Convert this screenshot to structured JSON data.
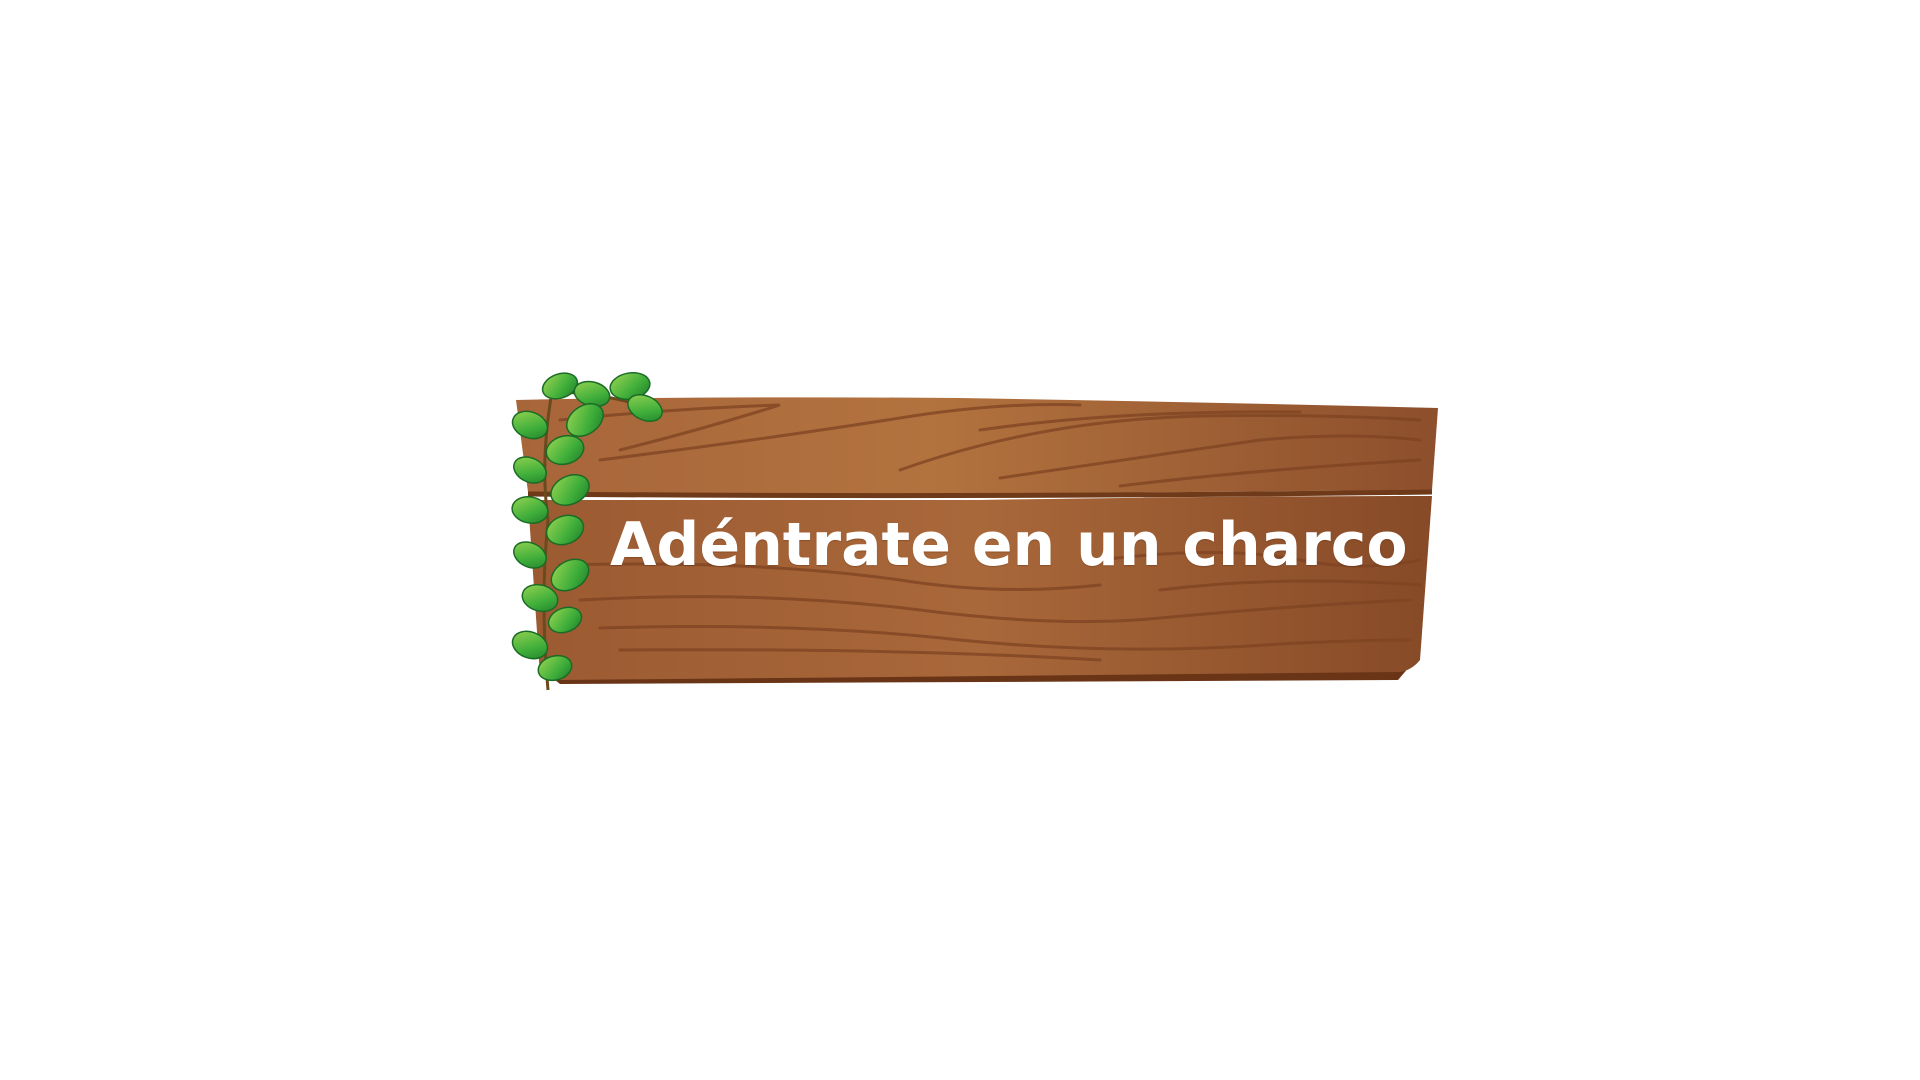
{
  "sign": {
    "title": "Adéntrate en un charco"
  },
  "colors": {
    "background": "#ffffff",
    "wood_light": "#b06f40",
    "wood_mid": "#9a5730",
    "wood_dark": "#6e3a19",
    "wood_grain": "#7e4322",
    "leaf_light": "#8ed04a",
    "leaf_dark": "#1f8a2e",
    "text": "#ffffff"
  },
  "icons": {
    "decoration": "ivy-vine-icon"
  }
}
